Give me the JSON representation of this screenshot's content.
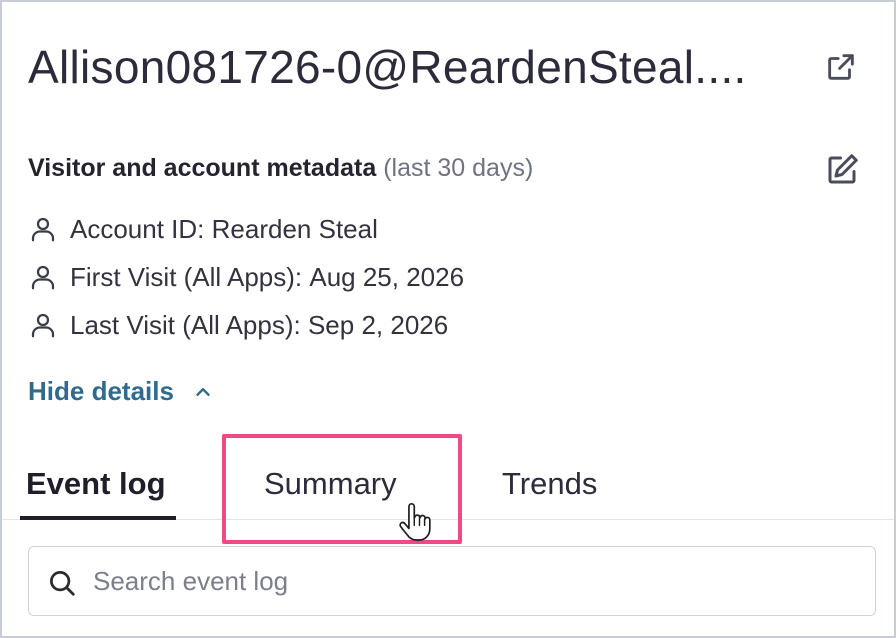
{
  "header": {
    "title": "Allison081726-0@ReardenSteal...."
  },
  "metadata": {
    "heading": "Visitor and account metadata",
    "heading_note": "(last 30 days)",
    "rows": [
      {
        "label": "Account ID:",
        "value": "Rearden Steal"
      },
      {
        "label": "First Visit (All Apps):",
        "value": "Aug 25, 2026"
      },
      {
        "label": "Last Visit (All Apps):",
        "value": "Sep 2, 2026"
      }
    ],
    "toggle_label": "Hide details"
  },
  "tabs": [
    {
      "label": "Event log",
      "active": true
    },
    {
      "label": "Summary",
      "active": false
    },
    {
      "label": "Trends",
      "active": false
    }
  ],
  "search": {
    "placeholder": "Search event log",
    "value": ""
  },
  "colors": {
    "link": "#2f6b8f",
    "highlight": "#ee4a86",
    "text": "#2b2b3a",
    "muted": "#6f7280"
  },
  "icons": {
    "title_action": "external-link-icon",
    "metadata_action": "edit-icon",
    "row_icon": "person-icon",
    "toggle_icon": "chevron-up-icon",
    "search_icon": "search-icon",
    "cursor": "hand-pointer-icon"
  }
}
